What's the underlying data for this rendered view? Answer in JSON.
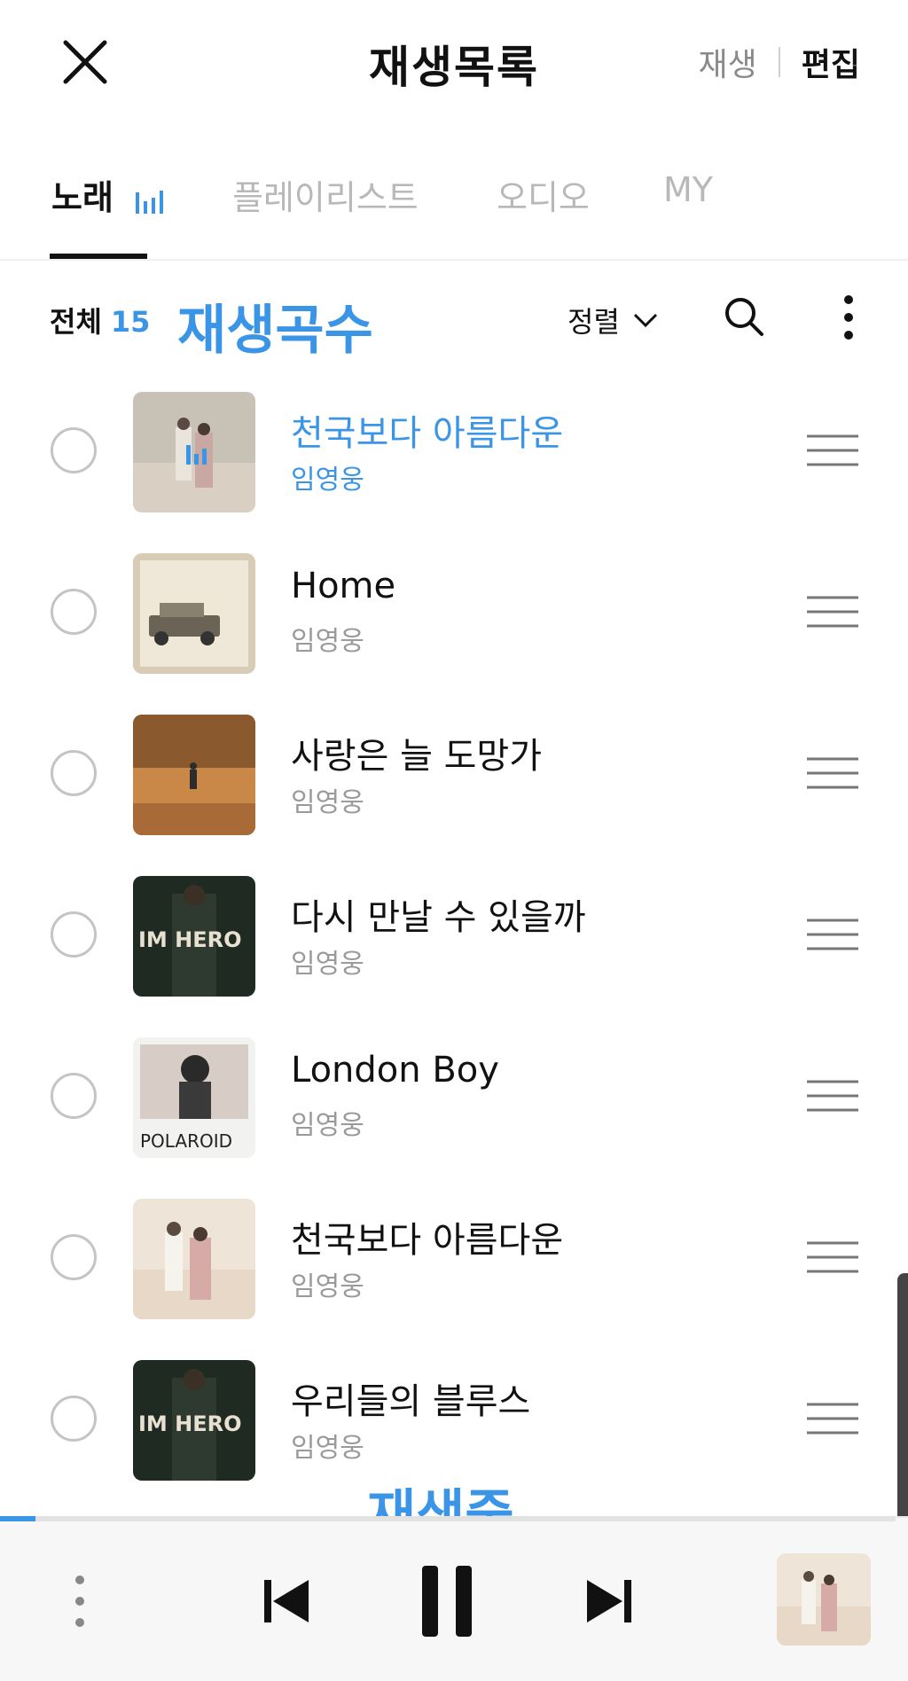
{
  "header": {
    "title": "재생목록",
    "play_label": "재생",
    "edit_label": "편집"
  },
  "tabs": [
    {
      "label": "노래",
      "active": true
    },
    {
      "label": "플레이리스트",
      "active": false
    },
    {
      "label": "오디오",
      "active": false
    },
    {
      "label": "MY",
      "active": false
    }
  ],
  "toolbar": {
    "total_label": "전체",
    "total_count": "15",
    "sort_label": "정렬"
  },
  "annotations": {
    "count_note": "재생곡수",
    "playing_note": "재생중"
  },
  "songs": [
    {
      "title": "천국보다 아름다운",
      "artist": "임영웅",
      "playing": true
    },
    {
      "title": "Home",
      "artist": "임영웅",
      "playing": false
    },
    {
      "title": "사랑은 늘 도망가",
      "artist": "임영웅",
      "playing": false
    },
    {
      "title": "다시 만날 수 있을까",
      "artist": "임영웅",
      "playing": false
    },
    {
      "title": "London Boy",
      "artist": "임영웅",
      "playing": false
    },
    {
      "title": "천국보다 아름다운",
      "artist": "임영웅",
      "playing": false
    },
    {
      "title": "우리들의 블루스",
      "artist": "임영웅",
      "playing": false
    }
  ],
  "album_text": {
    "im_hero": "IM HERO",
    "polaroid": "POLAROID"
  },
  "player": {
    "progress_fraction": 0.04
  },
  "colors": {
    "accent": "#3b95e6",
    "inactive_tab": "#b8b8b8",
    "artist_gray": "#9a9a9a"
  }
}
